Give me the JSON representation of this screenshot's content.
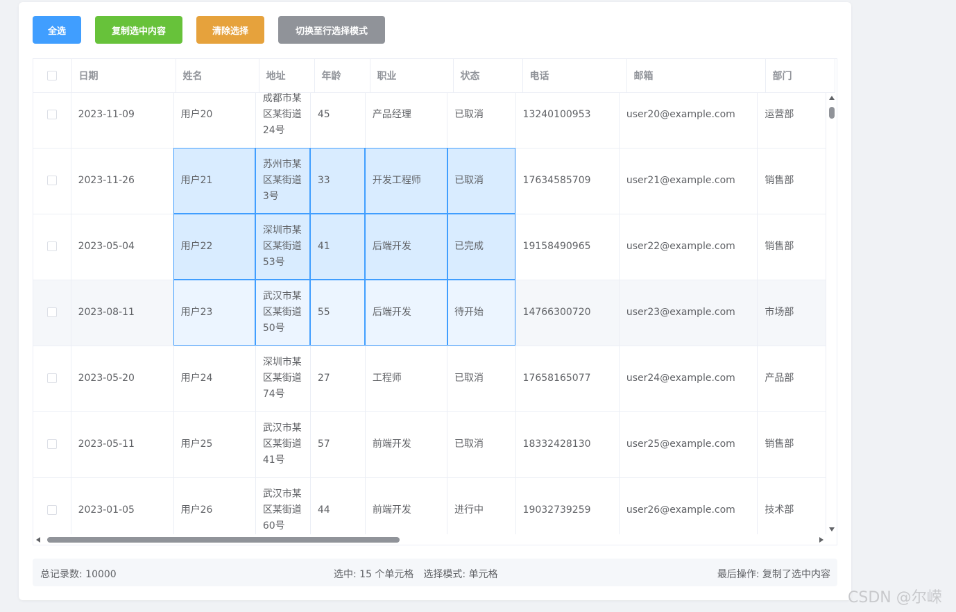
{
  "toolbar": {
    "select_all": "全选",
    "copy_selected": "复制选中内容",
    "clear_selection": "清除选择",
    "toggle_mode": "切换至行选择模式"
  },
  "colors": {
    "primary": "#409eff",
    "success": "#67c23a",
    "warning": "#e6a23c",
    "info": "#909399",
    "selected_cell_bg": "#d9ecff"
  },
  "table": {
    "columns": [
      "日期",
      "姓名",
      "地址",
      "年龄",
      "职业",
      "状态",
      "电话",
      "邮箱",
      "部门"
    ],
    "rows": [
      {
        "date": "2023-11-09",
        "name": "用户20",
        "address": "成都市某区某街道24号",
        "age": "45",
        "job": "产品经理",
        "status": "已取消",
        "phone": "13240100953",
        "email": "user20@example.com",
        "dept": "运营部",
        "selected": false,
        "hover": false
      },
      {
        "date": "2023-11-26",
        "name": "用户21",
        "address": "苏州市某区某街道3号",
        "age": "33",
        "job": "开发工程师",
        "status": "已取消",
        "phone": "17634585709",
        "email": "user21@example.com",
        "dept": "销售部",
        "selected": true,
        "hover": false
      },
      {
        "date": "2023-05-04",
        "name": "用户22",
        "address": "深圳市某区某街道53号",
        "age": "41",
        "job": "后端开发",
        "status": "已完成",
        "phone": "19158490965",
        "email": "user22@example.com",
        "dept": "销售部",
        "selected": true,
        "hover": false
      },
      {
        "date": "2023-08-11",
        "name": "用户23",
        "address": "武汉市某区某街道50号",
        "age": "55",
        "job": "后端开发",
        "status": "待开始",
        "phone": "14766300720",
        "email": "user23@example.com",
        "dept": "市场部",
        "selected": true,
        "hover": true
      },
      {
        "date": "2023-05-20",
        "name": "用户24",
        "address": "深圳市某区某街道74号",
        "age": "27",
        "job": "工程师",
        "status": "已取消",
        "phone": "17658165077",
        "email": "user24@example.com",
        "dept": "产品部",
        "selected": false,
        "hover": false
      },
      {
        "date": "2023-05-11",
        "name": "用户25",
        "address": "武汉市某区某街道41号",
        "age": "57",
        "job": "前端开发",
        "status": "已取消",
        "phone": "18332428130",
        "email": "user25@example.com",
        "dept": "销售部",
        "selected": false,
        "hover": false
      },
      {
        "date": "2023-01-05",
        "name": "用户26",
        "address": "武汉市某区某街道60号",
        "age": "44",
        "job": "前端开发",
        "status": "进行中",
        "phone": "19032739259",
        "email": "user26@example.com",
        "dept": "技术部",
        "selected": false,
        "hover": false
      }
    ]
  },
  "status_bar": {
    "total": "总记录数: 10000",
    "selection": "选中: 15 个单元格　选择模式: 单元格",
    "last_action": "最后操作: 复制了选中内容"
  },
  "watermark": "CSDN @尔嵘"
}
